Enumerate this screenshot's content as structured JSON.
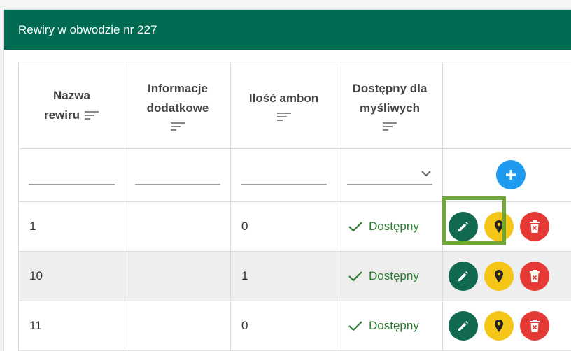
{
  "card": {
    "title": "Rewiry w obwodzie nr 227"
  },
  "table": {
    "columns": {
      "name_line1": "Nazwa",
      "name_line2": "rewiru",
      "info_line1": "Informacje",
      "info_line2": "dodatkowe",
      "count": "Ilość ambon",
      "avail_line1": "Dostępny dla",
      "avail_line2": "myśliwych"
    },
    "rows": [
      {
        "name": "1",
        "info": "",
        "count": "0",
        "status": "Dostępny"
      },
      {
        "name": "10",
        "info": "",
        "count": "1",
        "status": "Dostępny"
      },
      {
        "name": "11",
        "info": "",
        "count": "0",
        "status": "Dostępny"
      }
    ]
  },
  "colors": {
    "header": "#006a52",
    "edit": "#11694f",
    "map": "#f5c518",
    "delete": "#e53935",
    "add": "#1e9bf0",
    "status": "#2e7d32",
    "highlight": "#6fa832"
  },
  "icons": [
    "sort-icon",
    "chevron-down-icon",
    "plus-icon",
    "pencil-icon",
    "map-marker-icon",
    "trash-icon",
    "check-icon"
  ]
}
